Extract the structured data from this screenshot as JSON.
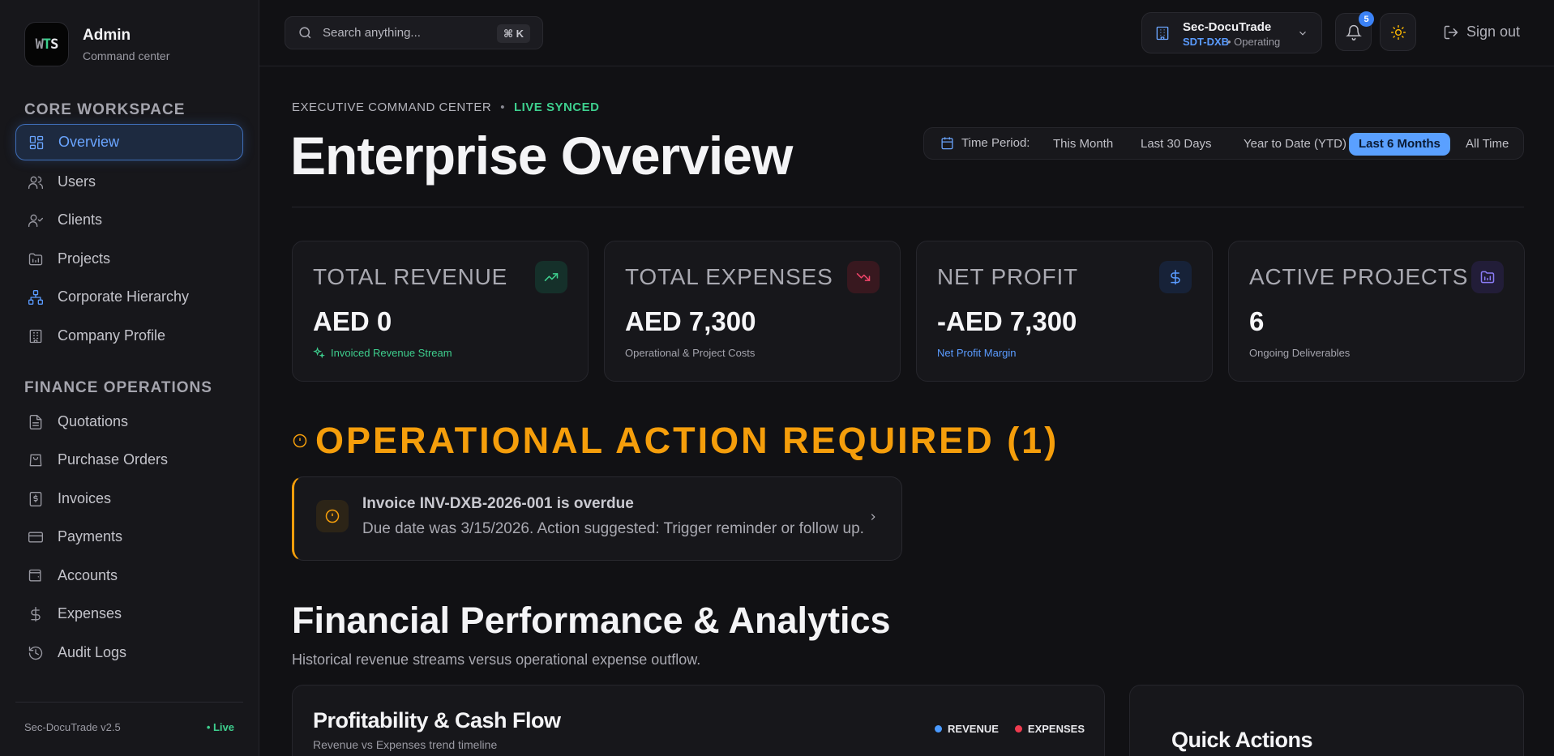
{
  "brand": {
    "logo_w": "W",
    "logo_t": "T",
    "logo_s": "S",
    "title": "Admin",
    "subtitle": "Command center"
  },
  "sidebar": {
    "core_label": "CORE WORKSPACE",
    "core_items": [
      {
        "label": "Overview",
        "icon": "grid-icon"
      },
      {
        "label": "Users",
        "icon": "users-icon"
      },
      {
        "label": "Clients",
        "icon": "user-check-icon"
      },
      {
        "label": "Projects",
        "icon": "folder-icon"
      },
      {
        "label": "Corporate Hierarchy",
        "icon": "network-icon"
      },
      {
        "label": "Company Profile",
        "icon": "building-icon"
      }
    ],
    "finance_label": "FINANCE OPERATIONS",
    "finance_items": [
      {
        "label": "Quotations",
        "icon": "document-icon"
      },
      {
        "label": "Purchase Orders",
        "icon": "shopping-bag-icon"
      },
      {
        "label": "Invoices",
        "icon": "invoice-icon"
      },
      {
        "label": "Payments",
        "icon": "credit-card-icon"
      },
      {
        "label": "Accounts",
        "icon": "wallet-icon"
      },
      {
        "label": "Expenses",
        "icon": "dollar-icon"
      },
      {
        "label": "Audit Logs",
        "icon": "history-icon"
      }
    ],
    "version": "Sec-DocuTrade v2.5",
    "live": "• Live"
  },
  "topbar": {
    "search_placeholder": "Search anything...",
    "shortcut": "⌘ K",
    "org_name": "Sec-DocuTrade",
    "org_code": "SDT-DXB",
    "org_status": "• Operating",
    "notification_count": "5",
    "signout": "Sign out"
  },
  "header": {
    "eyebrow": "EXECUTIVE COMMAND CENTER",
    "eyebrow_dot": "•",
    "sync_status": "LIVE SYNCED",
    "title": "Enterprise Overview"
  },
  "period": {
    "label": "Time Period:",
    "options": [
      "This Month",
      "Last 30 Days",
      "Year to Date (YTD)",
      "Last 6 Months",
      "All Time"
    ],
    "selected": "Last 6 Months"
  },
  "stats": [
    {
      "label": "TOTAL REVENUE",
      "value": "AED 0",
      "sub": "Invoiced Revenue Stream",
      "sub_color": "#3ecf8e",
      "icon": "trending-up-icon",
      "accent": "#3ecf8e"
    },
    {
      "label": "TOTAL EXPENSES",
      "value": "AED 7,300",
      "sub": "Operational & Project Costs",
      "sub_color": "#a4a4ad",
      "icon": "trending-down-icon",
      "accent": "#f0446a"
    },
    {
      "label": "NET PROFIT",
      "value": "-AED 7,300",
      "sub": "Net Profit Margin",
      "sub_color": "#5a9bff",
      "icon": "dollar-icon",
      "accent": "#5a9bff"
    },
    {
      "label": "ACTIVE PROJECTS",
      "value": "6",
      "sub": "Ongoing Deliverables",
      "sub_color": "#a4a4ad",
      "icon": "folder-icon",
      "accent": "#8b7cf6"
    }
  ],
  "alerts": {
    "title": "OPERATIONAL ACTION REQUIRED (1)",
    "items": [
      {
        "title": "Invoice INV-DXB-2026-001 is overdue",
        "desc": "Due date was 3/15/2026. Action suggested: Trigger reminder or follow up."
      }
    ]
  },
  "analytics": {
    "title": "Financial Performance & Analytics",
    "subtitle": "Historical revenue streams versus operational expense outflow.",
    "chart_title": "Profitability & Cash Flow",
    "chart_subtitle": "Revenue vs Expenses trend timeline",
    "legend": [
      {
        "name": "REVENUE",
        "color": "#4a9aff"
      },
      {
        "name": "EXPENSES",
        "color": "#ef3b4f"
      }
    ],
    "quick_actions_title": "Quick Actions"
  },
  "colors": {
    "accent": "#5aa0ff",
    "success": "#3ecf8e",
    "warning": "#f59e0b",
    "danger": "#f0446a"
  }
}
